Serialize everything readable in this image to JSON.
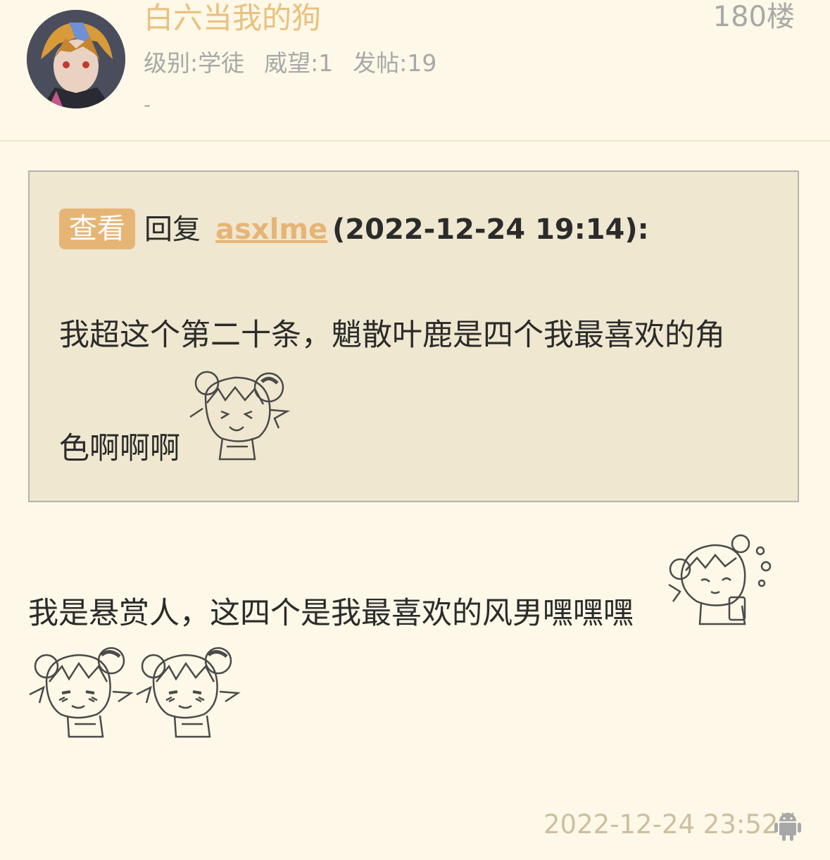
{
  "post": {
    "author": "白六当我的狗",
    "floor": "180楼",
    "level": "级别:学徒",
    "prestige": "威望:1",
    "posts": "发帖:19",
    "signature": "-"
  },
  "quote": {
    "view_label": "查看",
    "reply_label": "回复",
    "reply_user": "asxlme",
    "reply_date": "(2022-12-24 19:14):",
    "text_line1": "我超这个第二十条，魈散叶鹿是四个我最喜欢的角",
    "text_line2": "色啊啊啊"
  },
  "body": {
    "text": "我是悬赏人，这四个是我最喜欢的风男嘿嘿嘿"
  },
  "footer": {
    "timestamp": "2022-12-24 23:52",
    "device_icon": "android-icon"
  },
  "colors": {
    "background": "#fdf8e7",
    "accent": "#e6b576",
    "quote_bg": "#efe7cf",
    "muted": "#a8a8a8"
  }
}
